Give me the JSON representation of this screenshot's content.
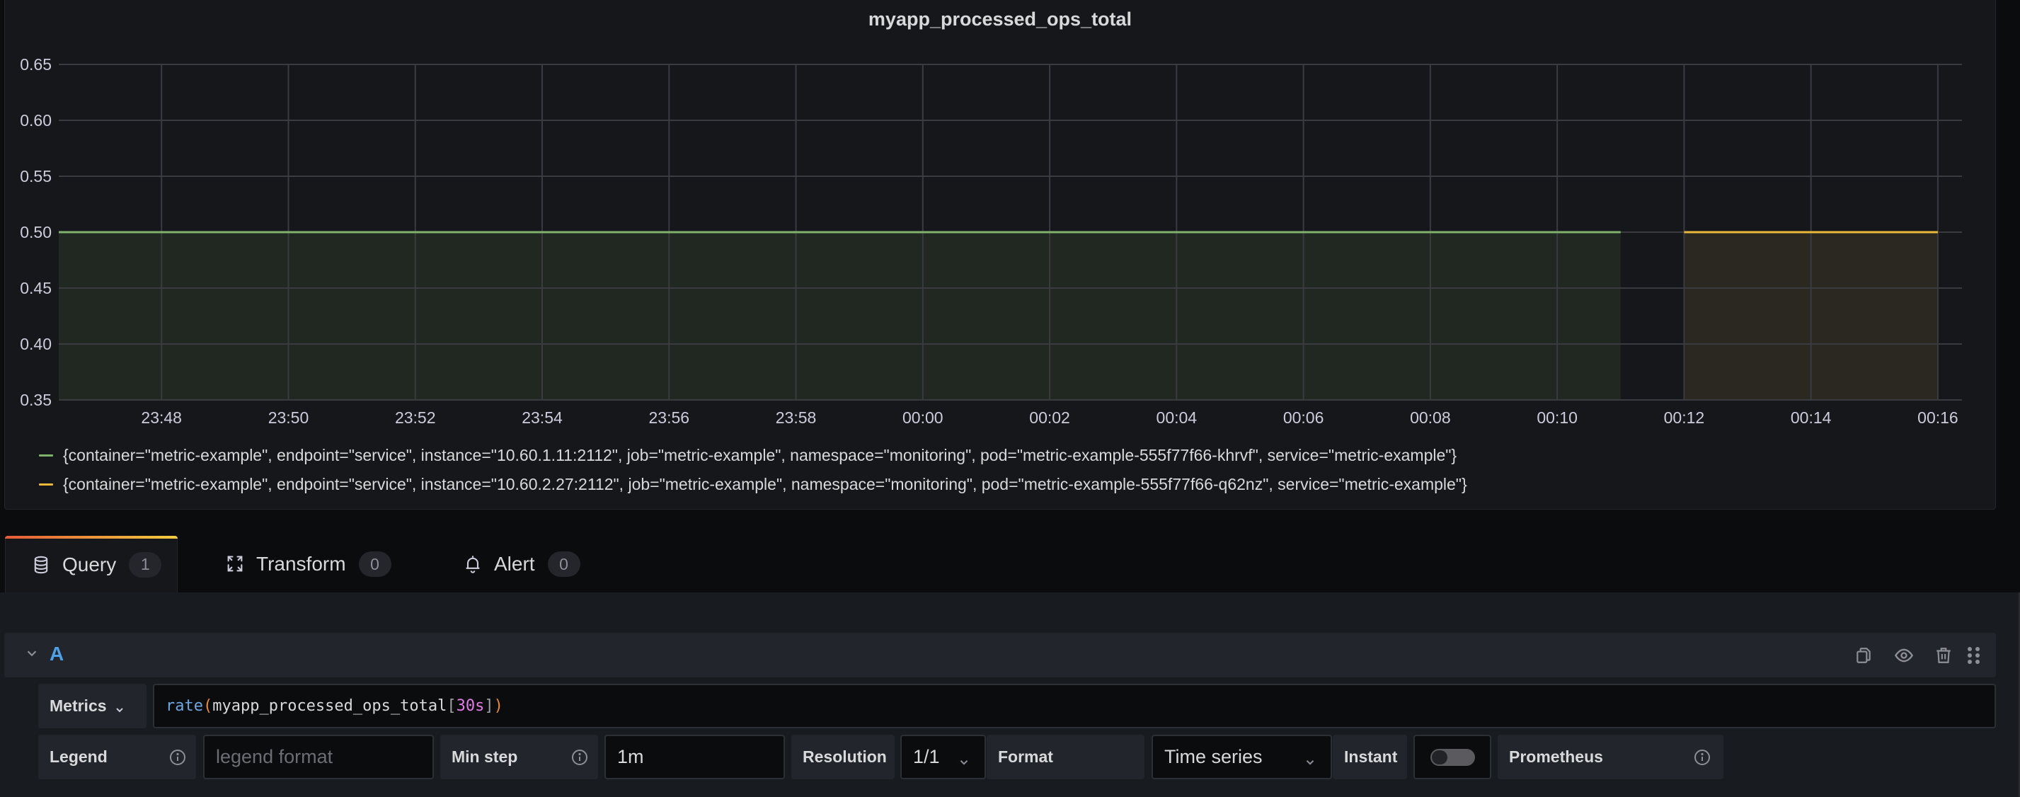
{
  "panel": {
    "title": "myapp_processed_ops_total"
  },
  "chart_data": {
    "type": "area",
    "title": "myapp_processed_ops_total",
    "xlabel": "",
    "ylabel": "",
    "x_unit": "minutes after 23:00",
    "xlim": [
      46.38,
      76.38
    ],
    "ylim": [
      0.35,
      0.65
    ],
    "yticks": [
      0.35,
      0.4,
      0.45,
      0.5,
      0.55,
      0.6,
      0.65
    ],
    "ytick_labels": [
      "0.35",
      "0.40",
      "0.45",
      "0.50",
      "0.55",
      "0.60",
      "0.65"
    ],
    "xticks": [
      48,
      50,
      52,
      54,
      56,
      58,
      60,
      62,
      64,
      66,
      68,
      70,
      72,
      74,
      76
    ],
    "xtick_labels": [
      "23:48",
      "23:50",
      "23:52",
      "23:54",
      "23:56",
      "23:58",
      "00:00",
      "00:02",
      "00:04",
      "00:06",
      "00:08",
      "00:10",
      "00:12",
      "00:14",
      "00:16"
    ],
    "grid": true,
    "legend_position": "bottom-left",
    "series": [
      {
        "name": "{container=\"metric-example\", endpoint=\"service\", instance=\"10.60.1.11:2112\", job=\"metric-example\", namespace=\"monitoring\", pod=\"metric-example-555f77f66-khrvf\", service=\"metric-example\"}",
        "color": "#7eb26d",
        "fill": "#212721",
        "x": [
          46.38,
          71.0
        ],
        "values": [
          0.5,
          0.5
        ]
      },
      {
        "name": "{container=\"metric-example\", endpoint=\"service\", instance=\"10.60.2.27:2112\", job=\"metric-example\", namespace=\"monitoring\", pod=\"metric-example-555f77f66-q62nz\", service=\"metric-example\"}",
        "color": "#eab839",
        "fill": "#2b2821",
        "x": [
          72.0,
          76.0
        ],
        "values": [
          0.5,
          0.5
        ]
      }
    ]
  },
  "tabs": [
    {
      "label": "Query",
      "count": "1",
      "icon": "database-icon",
      "active": true
    },
    {
      "label": "Transform",
      "count": "0",
      "icon": "transform-icon",
      "active": false
    },
    {
      "label": "Alert",
      "count": "0",
      "icon": "bell-icon",
      "active": false
    }
  ],
  "query": {
    "ref_id": "A",
    "metrics_label": "Metrics",
    "expr_parts": {
      "fn": "rate",
      "open": "(",
      "metric": "myapp_processed_ops_total",
      "lb": "[",
      "range": "30s",
      "rb": "]",
      "close": ")"
    },
    "legend_label": "Legend",
    "legend_placeholder": "legend format",
    "min_step_label": "Min step",
    "min_step_value": "1m",
    "resolution_label": "Resolution",
    "resolution_value": "1/1",
    "format_label": "Format",
    "format_value": "Time series",
    "instant_label": "Instant",
    "instant_on": false,
    "datasource_label": "Prometheus"
  },
  "colors": {
    "fn": "#6ea6e0",
    "paren": "#e88a3a",
    "range": "#e27be8",
    "ref": "#4ea1e6"
  }
}
